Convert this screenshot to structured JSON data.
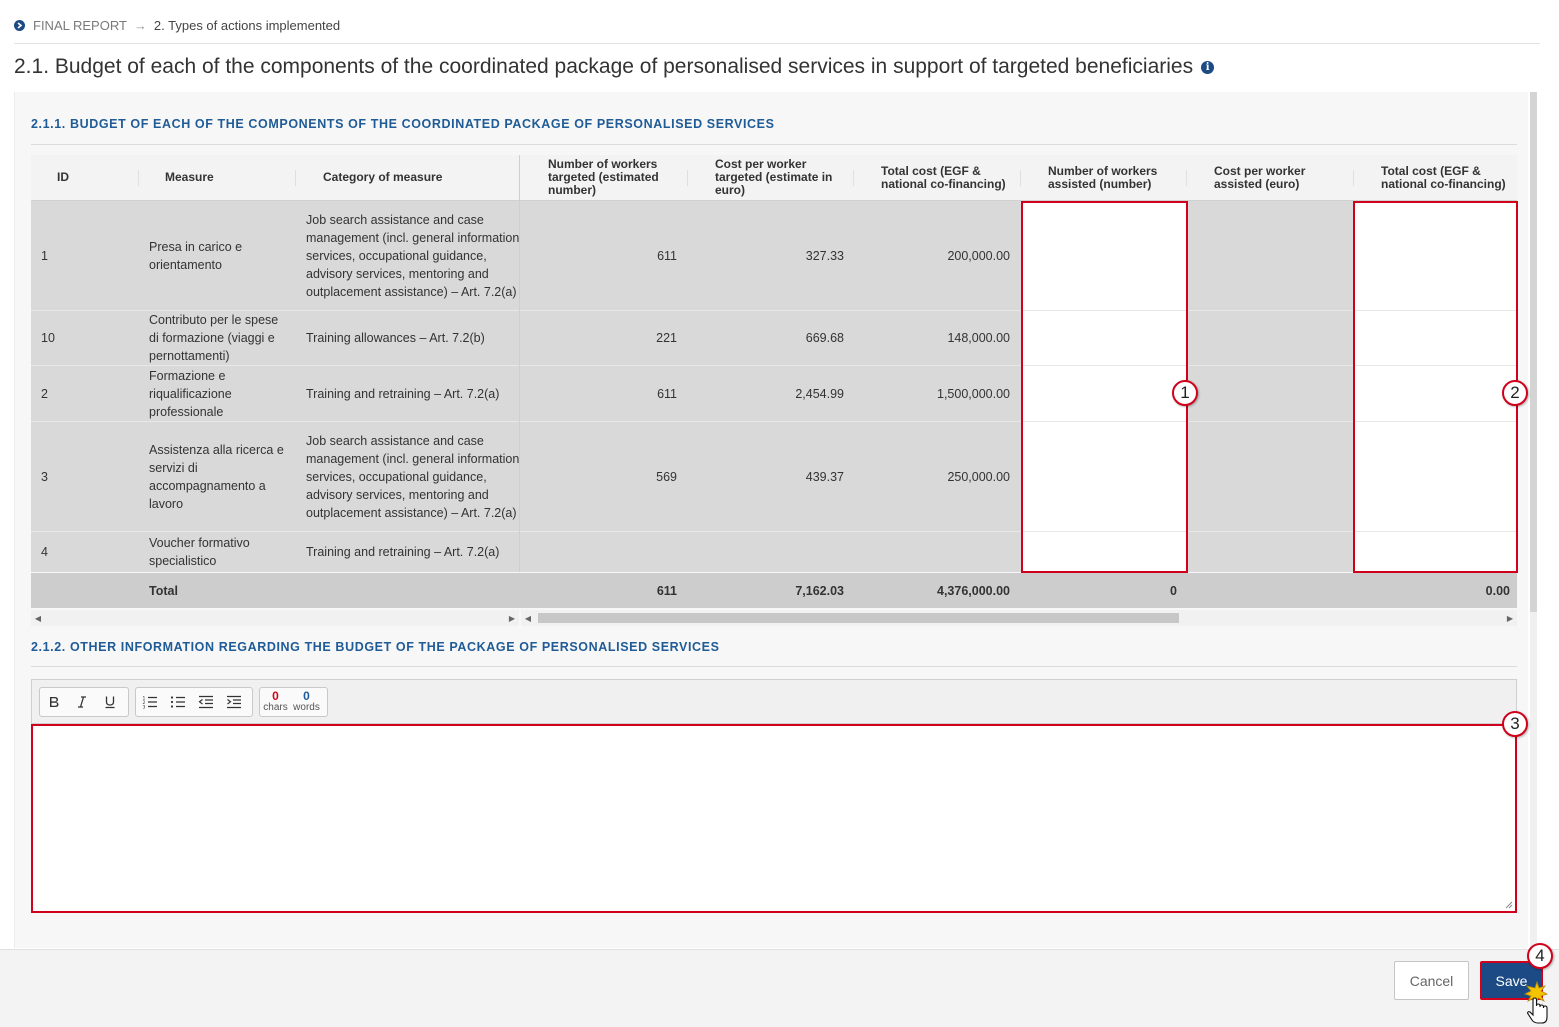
{
  "breadcrumb": {
    "root": "FINAL REPORT",
    "separator": "→",
    "current": "2. Types of actions implemented"
  },
  "page_title": "2.1. Budget of each of the components of the coordinated package of personalised services in support of targeted beneficiaries",
  "section1_title": "2.1.1. Budget of each of the components of the coordinated package of personalised services",
  "section2_title": "2.1.2. Other information regarding the budget of the package of personalised services",
  "table": {
    "headers": {
      "id": "ID",
      "measure": "Measure",
      "category": "Category of measure",
      "workers_targeted": "Number of workers targeted (estimated number)",
      "cost_targeted": "Cost per worker targeted (estimate in euro)",
      "total_targeted": "Total cost (EGF & national co-financing)",
      "workers_assisted": "Number of workers assisted (number)",
      "cost_assisted": "Cost per worker assisted (euro)",
      "total_assisted": "Total cost (EGF & national co-financing)"
    },
    "rows": [
      {
        "id": "1",
        "measure": "Presa in carico e orientamento",
        "category": "Job search assistance and case management (incl. general information services, occupational guidance, advisory services, mentoring and outplacement assistance) – Art. 7.2(a)",
        "workers_targeted": "611",
        "cost_targeted": "327.33",
        "total_targeted": "200,000.00"
      },
      {
        "id": "10",
        "measure": "Contributo per le spese di formazione (viaggi e pernottamenti)",
        "category": "Training allowances – Art. 7.2(b)",
        "workers_targeted": "221",
        "cost_targeted": "669.68",
        "total_targeted": "148,000.00"
      },
      {
        "id": "2",
        "measure": "Formazione e riqualificazione professionale",
        "category": "Training and retraining – Art. 7.2(a)",
        "workers_targeted": "611",
        "cost_targeted": "2,454.99",
        "total_targeted": "1,500,000.00"
      },
      {
        "id": "3",
        "measure": "Assistenza alla ricerca e servizi di accompagnamento a lavoro",
        "category": "Job search assistance and case management (incl. general information services, occupational guidance, advisory services, mentoring and outplacement assistance) – Art. 7.2(a)",
        "workers_targeted": "569",
        "cost_targeted": "439.37",
        "total_targeted": "250,000.00"
      },
      {
        "id": "4",
        "measure": "Voucher formativo specialistico",
        "category": "Training and retraining – Art. 7.2(a)",
        "workers_targeted": "",
        "cost_targeted": "",
        "total_targeted": ""
      }
    ],
    "total": {
      "label": "Total",
      "workers_targeted": "611",
      "cost_targeted": "7,162.03",
      "total_targeted": "4,376,000.00",
      "workers_assisted": "0",
      "total_assisted": "0.00"
    }
  },
  "editor": {
    "chars_count": "0",
    "chars_label": "chars",
    "words_count": "0",
    "words_label": "words"
  },
  "callouts": [
    "1",
    "2",
    "3",
    "4"
  ],
  "buttons": {
    "cancel": "Cancel",
    "save": "Save"
  },
  "colors": {
    "accent": "#1c4a85",
    "section_title": "#1f5b96",
    "highlight": "#d0021b",
    "chars_count": "#d0021b",
    "words_count": "#1f5b96"
  }
}
